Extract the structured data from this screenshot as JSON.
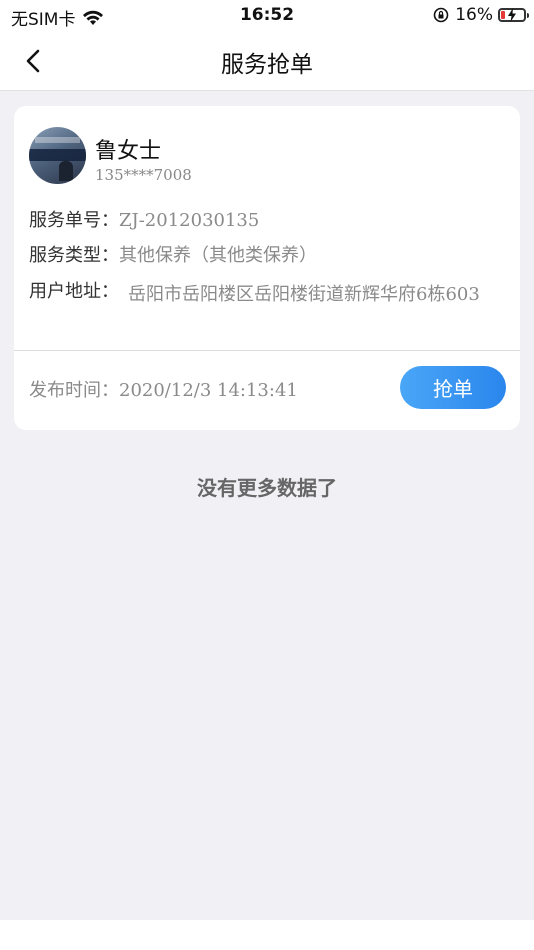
{
  "status_bar": {
    "carrier": "无SIM卡",
    "time": "16:52",
    "battery_percent": "16%",
    "battery_level": 0.16,
    "icons": [
      "wifi-icon",
      "orientation-lock-icon",
      "battery-charging-icon"
    ]
  },
  "nav": {
    "title": "服务抢单",
    "back_icon": "chevron-left-icon"
  },
  "order": {
    "customer_name": "鲁女士",
    "customer_phone": "135****7008",
    "service_no_label": "服务单号：",
    "service_no": "ZJ-2012030135",
    "service_type_label": "服务类型：",
    "service_type": "其他保养（其他类保养）",
    "address_label": "用户地址：",
    "address": "岳阳市岳阳楼区岳阳楼街道新辉华府6栋603",
    "publish_time_label": "发布时间：",
    "publish_time": "2020/12/3 14:13:41",
    "grab_button": "抢单"
  },
  "list_footer": "没有更多数据了",
  "colors": {
    "accent": "#2a86ec",
    "background": "#f1f0f5",
    "battery_low": "#e53935"
  }
}
